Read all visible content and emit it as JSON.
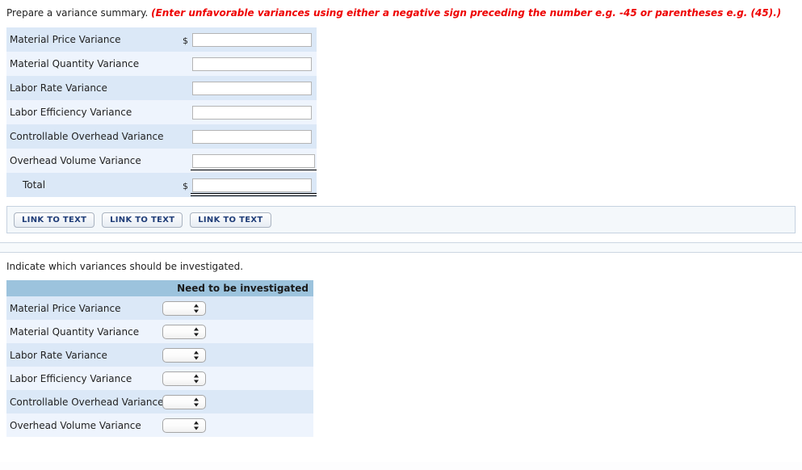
{
  "section1": {
    "prompt": "Prepare a variance summary.",
    "instruction": "(Enter unfavorable variances using either a negative sign preceding the number e.g. -45 or parentheses e.g. (45).)",
    "currency_symbol": "$",
    "rows": [
      {
        "label": "Material Price Variance",
        "value": "",
        "prefix": "$"
      },
      {
        "label": "Material Quantity Variance",
        "value": "",
        "prefix": ""
      },
      {
        "label": "Labor Rate Variance",
        "value": "",
        "prefix": ""
      },
      {
        "label": "Labor Efficiency Variance",
        "value": "",
        "prefix": ""
      },
      {
        "label": "Controllable Overhead Variance",
        "value": "",
        "prefix": ""
      },
      {
        "label": "Overhead Volume Variance",
        "value": "",
        "prefix": ""
      },
      {
        "label": "Total",
        "value": "",
        "prefix": "$"
      }
    ]
  },
  "link_panel": {
    "buttons": [
      {
        "label": "LINK TO TEXT"
      },
      {
        "label": "LINK TO TEXT"
      },
      {
        "label": "LINK TO TEXT"
      }
    ]
  },
  "section2": {
    "prompt": "Indicate which variances should be investigated.",
    "column_header": "Need to be investigated",
    "rows": [
      {
        "label": "Material Price Variance",
        "selected": ""
      },
      {
        "label": "Material Quantity Variance",
        "selected": ""
      },
      {
        "label": "Labor Rate Variance",
        "selected": ""
      },
      {
        "label": "Labor Efficiency Variance",
        "selected": ""
      },
      {
        "label": "Controllable Overhead Variance",
        "selected": ""
      },
      {
        "label": "Overhead Volume Variance",
        "selected": ""
      }
    ]
  },
  "colors": {
    "instruction_red": "#ee0000",
    "row_dark": "#dbe8f7",
    "row_light": "#eef4fd",
    "header_blue": "#9cc3dd",
    "button_text": "#1f3d78"
  }
}
